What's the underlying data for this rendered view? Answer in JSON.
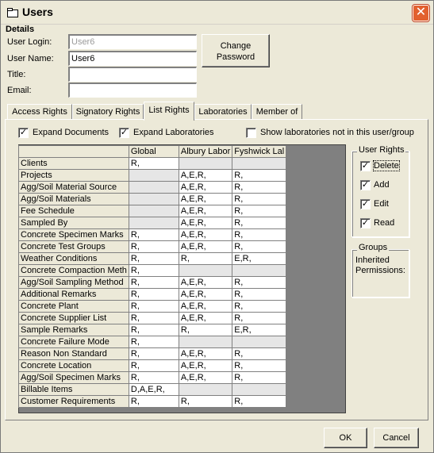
{
  "window": {
    "title": "Users",
    "close_label": "✕"
  },
  "details": {
    "heading": "Details",
    "user_login_label": "User Login:",
    "user_login_value": "User6",
    "user_name_label": "User Name:",
    "user_name_value": "User6",
    "title_label": "Title:",
    "title_value": "",
    "email_label": "Email:",
    "email_value": "",
    "change_password_line1": "Change",
    "change_password_line2": "Password"
  },
  "tabs": [
    {
      "label": "Access Rights"
    },
    {
      "label": "Signatory Rights"
    },
    {
      "label": "List Rights"
    },
    {
      "label": "Laboratories"
    },
    {
      "label": "Member of"
    }
  ],
  "active_tab": "List Rights",
  "options": {
    "expand_documents": {
      "label": "Expand Documents",
      "checked": true
    },
    "expand_laboratories": {
      "label": "Expand Laboratories",
      "checked": true
    },
    "show_labs": {
      "label": "Show laboratories not in this user/group",
      "checked": false
    }
  },
  "grid": {
    "columns": [
      "Global",
      "Albury Labor",
      "Fyshwick Lal"
    ],
    "rows": [
      {
        "name": "Clients",
        "values": [
          "R,",
          "",
          ""
        ],
        "disabled": [
          false,
          true,
          true
        ]
      },
      {
        "name": "Projects",
        "values": [
          "",
          "A,E,R,",
          "R,"
        ],
        "disabled": [
          true,
          false,
          false
        ]
      },
      {
        "name": "Agg/Soil Material Source",
        "values": [
          "",
          "A,E,R,",
          "R,"
        ],
        "disabled": [
          true,
          false,
          false
        ]
      },
      {
        "name": "Agg/Soil Materials",
        "values": [
          "",
          "A,E,R,",
          "R,"
        ],
        "disabled": [
          true,
          false,
          false
        ]
      },
      {
        "name": "Fee Schedule",
        "values": [
          "",
          "A,E,R,",
          "R,"
        ],
        "disabled": [
          true,
          false,
          false
        ]
      },
      {
        "name": "Sampled By",
        "values": [
          "",
          "A,E,R,",
          "R,"
        ],
        "disabled": [
          true,
          false,
          false
        ]
      },
      {
        "name": "Concrete Specimen Marks",
        "values": [
          "R,",
          "A,E,R,",
          "R,"
        ],
        "disabled": [
          false,
          false,
          false
        ]
      },
      {
        "name": "Concrete Test Groups",
        "values": [
          "R,",
          "A,E,R,",
          "R,"
        ],
        "disabled": [
          false,
          false,
          false
        ]
      },
      {
        "name": "Weather Conditions",
        "values": [
          "R,",
          "R,",
          "E,R,"
        ],
        "disabled": [
          false,
          false,
          false
        ]
      },
      {
        "name": "Concrete Compaction Meth",
        "values": [
          "R,",
          "",
          ""
        ],
        "disabled": [
          false,
          true,
          true
        ]
      },
      {
        "name": "Agg/Soil Sampling Method",
        "values": [
          "R,",
          "A,E,R,",
          "R,"
        ],
        "disabled": [
          false,
          false,
          false
        ]
      },
      {
        "name": "Additional Remarks",
        "values": [
          "R,",
          "A,E,R,",
          "R,"
        ],
        "disabled": [
          false,
          false,
          false
        ]
      },
      {
        "name": "Concrete Plant",
        "values": [
          "R,",
          "A,E,R,",
          "R,"
        ],
        "disabled": [
          false,
          false,
          false
        ]
      },
      {
        "name": "Concrete Supplier List",
        "values": [
          "R,",
          "A,E,R,",
          "R,"
        ],
        "disabled": [
          false,
          false,
          false
        ]
      },
      {
        "name": "Sample Remarks",
        "values": [
          "R,",
          "R,",
          "E,R,"
        ],
        "disabled": [
          false,
          false,
          false
        ]
      },
      {
        "name": "Concrete Failure Mode",
        "values": [
          "R,",
          "",
          ""
        ],
        "disabled": [
          false,
          true,
          true
        ]
      },
      {
        "name": "Reason Non Standard",
        "values": [
          "R,",
          "A,E,R,",
          "R,"
        ],
        "disabled": [
          false,
          false,
          false
        ]
      },
      {
        "name": "Concrete Location",
        "values": [
          "R,",
          "A,E,R,",
          "R,"
        ],
        "disabled": [
          false,
          false,
          false
        ]
      },
      {
        "name": "Agg/Soil Specimen Marks",
        "values": [
          "R,",
          "A,E,R,",
          "R,"
        ],
        "disabled": [
          false,
          false,
          false
        ]
      },
      {
        "name": "Billable Items",
        "values": [
          "D,A,E,R,",
          "",
          ""
        ],
        "disabled": [
          false,
          true,
          true
        ]
      },
      {
        "name": "Customer Requirements",
        "values": [
          "R,",
          "R,",
          "R,"
        ],
        "disabled": [
          false,
          false,
          false
        ]
      }
    ]
  },
  "user_rights": {
    "heading": "User Rights",
    "items": [
      {
        "label": "Delete",
        "checked": true
      },
      {
        "label": "Add",
        "checked": true
      },
      {
        "label": "Edit",
        "checked": true
      },
      {
        "label": "Read",
        "checked": true
      }
    ]
  },
  "groups": {
    "heading": "Groups",
    "text_line1": "Inherited",
    "text_line2": "Permissions:"
  },
  "footer": {
    "ok_label": "OK",
    "cancel_label": "Cancel"
  }
}
